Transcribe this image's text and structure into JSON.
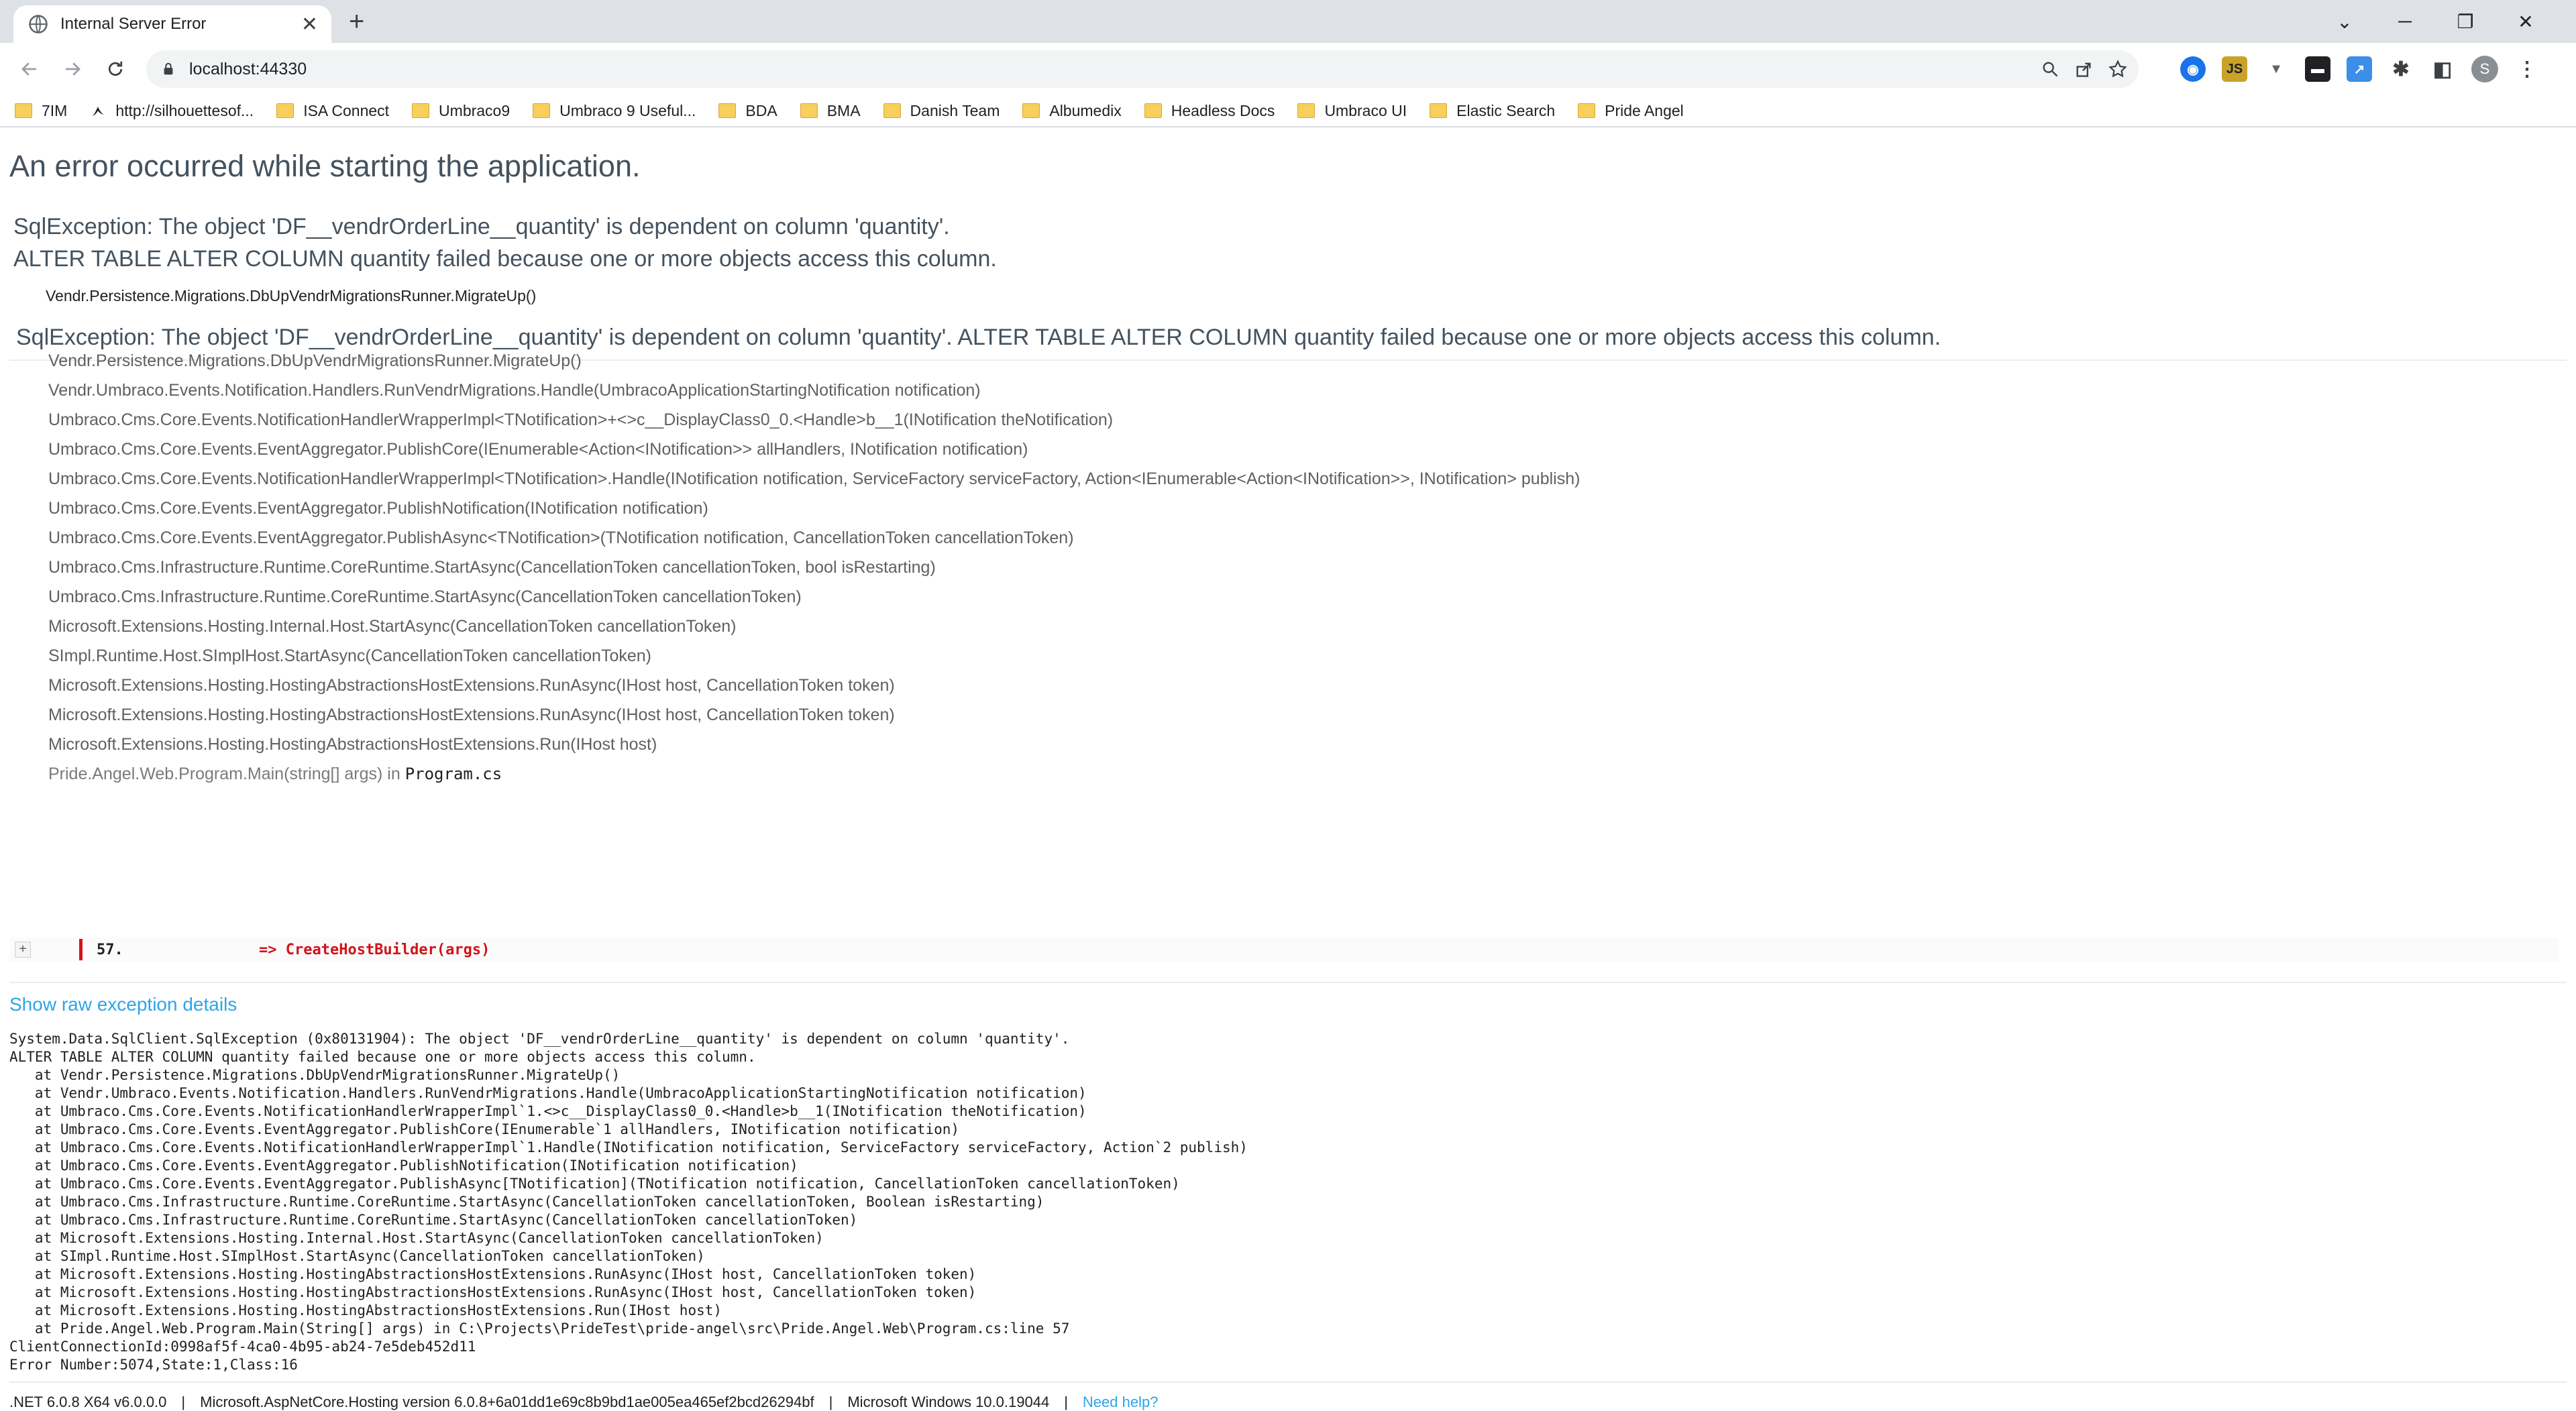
{
  "browser": {
    "tab_title": "Internal Server Error",
    "url": "localhost:44330",
    "avatar_letter": "S",
    "bookmarks": [
      {
        "label": "7IM",
        "icon": "folder-icon"
      },
      {
        "label": "http://silhouettesof...",
        "icon": "web-icon"
      },
      {
        "label": "ISA Connect",
        "icon": "folder-icon"
      },
      {
        "label": "Umbraco9",
        "icon": "folder-icon"
      },
      {
        "label": "Umbraco  9 Useful...",
        "icon": "folder-icon"
      },
      {
        "label": "BDA",
        "icon": "folder-icon"
      },
      {
        "label": "BMA",
        "icon": "folder-icon"
      },
      {
        "label": "Danish Team",
        "icon": "folder-icon"
      },
      {
        "label": "Albumedix",
        "icon": "folder-icon"
      },
      {
        "label": "Headless Docs",
        "icon": "folder-icon"
      },
      {
        "label": "Umbraco UI",
        "icon": "folder-icon"
      },
      {
        "label": "Elastic Search",
        "icon": "folder-icon"
      },
      {
        "label": "Pride Angel",
        "icon": "folder-icon"
      }
    ]
  },
  "error": {
    "title": "An error occurred while starting the application.",
    "message_line1": "SqlException: The object 'DF__vendrOrderLine__quantity' is dependent on column 'quantity'.",
    "message_line2": "ALTER TABLE ALTER COLUMN quantity failed because one or more objects access this column.",
    "location": "Vendr.Persistence.Migrations.DbUpVendrMigrationsRunner.MigrateUp()",
    "message_full": "SqlException: The object 'DF__vendrOrderLine__quantity' is dependent on column 'quantity'. ALTER TABLE ALTER COLUMN quantity failed because one or more objects access this column.",
    "frames": [
      "Vendr.Persistence.Migrations.DbUpVendrMigrationsRunner.MigrateUp()",
      "Vendr.Umbraco.Events.Notification.Handlers.RunVendrMigrations.Handle(UmbracoApplicationStartingNotification notification)",
      "Umbraco.Cms.Core.Events.NotificationHandlerWrapperImpl<TNotification>+<>c__DisplayClass0_0.<Handle>b__1(INotification theNotification)",
      "Umbraco.Cms.Core.Events.EventAggregator.PublishCore(IEnumerable<Action<INotification>> allHandlers, INotification notification)",
      "Umbraco.Cms.Core.Events.NotificationHandlerWrapperImpl<TNotification>.Handle(INotification notification, ServiceFactory serviceFactory, Action<IEnumerable<Action<INotification>>, INotification> publish)",
      "Umbraco.Cms.Core.Events.EventAggregator.PublishNotification(INotification notification)",
      "Umbraco.Cms.Core.Events.EventAggregator.PublishAsync<TNotification>(TNotification notification, CancellationToken cancellationToken)",
      "Umbraco.Cms.Infrastructure.Runtime.CoreRuntime.StartAsync(CancellationToken cancellationToken, bool isRestarting)",
      "Umbraco.Cms.Infrastructure.Runtime.CoreRuntime.StartAsync(CancellationToken cancellationToken)",
      "Microsoft.Extensions.Hosting.Internal.Host.StartAsync(CancellationToken cancellationToken)",
      "SImpl.Runtime.Host.SImplHost.StartAsync(CancellationToken cancellationToken)",
      "Microsoft.Extensions.Hosting.HostingAbstractionsHostExtensions.RunAsync(IHost host, CancellationToken token)",
      "Microsoft.Extensions.Hosting.HostingAbstractionsHostExtensions.RunAsync(IHost host, CancellationToken token)",
      "Microsoft.Extensions.Hosting.HostingAbstractionsHostExtensions.Run(IHost host)"
    ],
    "source_frame": "Pride.Angel.Web.Program.Main(string[] args) in",
    "source_file": "Program.cs",
    "code_expander": "+",
    "code_line_number": "57.",
    "code_line": "=> CreateHostBuilder(args)",
    "show_raw_label": "Show raw exception details",
    "raw_lines": [
      "System.Data.SqlClient.SqlException (0x80131904): The object 'DF__vendrOrderLine__quantity' is dependent on column 'quantity'.",
      "ALTER TABLE ALTER COLUMN quantity failed because one or more objects access this column.",
      "   at Vendr.Persistence.Migrations.DbUpVendrMigrationsRunner.MigrateUp()",
      "   at Vendr.Umbraco.Events.Notification.Handlers.RunVendrMigrations.Handle(UmbracoApplicationStartingNotification notification)",
      "   at Umbraco.Cms.Core.Events.NotificationHandlerWrapperImpl`1.<>c__DisplayClass0_0.<Handle>b__1(INotification theNotification)",
      "   at Umbraco.Cms.Core.Events.EventAggregator.PublishCore(IEnumerable`1 allHandlers, INotification notification)",
      "   at Umbraco.Cms.Core.Events.NotificationHandlerWrapperImpl`1.Handle(INotification notification, ServiceFactory serviceFactory, Action`2 publish)",
      "   at Umbraco.Cms.Core.Events.EventAggregator.PublishNotification(INotification notification)",
      "   at Umbraco.Cms.Core.Events.EventAggregator.PublishAsync[TNotification](TNotification notification, CancellationToken cancellationToken)",
      "   at Umbraco.Cms.Infrastructure.Runtime.CoreRuntime.StartAsync(CancellationToken cancellationToken, Boolean isRestarting)",
      "   at Umbraco.Cms.Infrastructure.Runtime.CoreRuntime.StartAsync(CancellationToken cancellationToken)",
      "   at Microsoft.Extensions.Hosting.Internal.Host.StartAsync(CancellationToken cancellationToken)",
      "   at SImpl.Runtime.Host.SImplHost.StartAsync(CancellationToken cancellationToken)",
      "   at Microsoft.Extensions.Hosting.HostingAbstractionsHostExtensions.RunAsync(IHost host, CancellationToken token)",
      "   at Microsoft.Extensions.Hosting.HostingAbstractionsHostExtensions.RunAsync(IHost host, CancellationToken token)",
      "   at Microsoft.Extensions.Hosting.HostingAbstractionsHostExtensions.Run(IHost host)",
      "   at Pride.Angel.Web.Program.Main(String[] args) in C:\\Projects\\PrideTest\\pride-angel\\src\\Pride.Angel.Web\\Program.cs:line 57",
      "ClientConnectionId:0998af5f-4ca0-4b95-ab24-7e5deb452d11",
      "Error Number:5074,State:1,Class:16"
    ]
  },
  "footer": {
    "runtime": ".NET 6.0.8 X64 v6.0.0.0",
    "hosting": "Microsoft.AspNetCore.Hosting version 6.0.8+6a01dd1e69c8b9bd1ae005ea465ef2bcd26294bf",
    "os": "Microsoft Windows 10.0.19044",
    "help_link": "Need help?",
    "separator": "|"
  },
  "colors": {
    "link": "#2fa4e7",
    "error_red": "#d0141a",
    "heading": "#44525e"
  }
}
